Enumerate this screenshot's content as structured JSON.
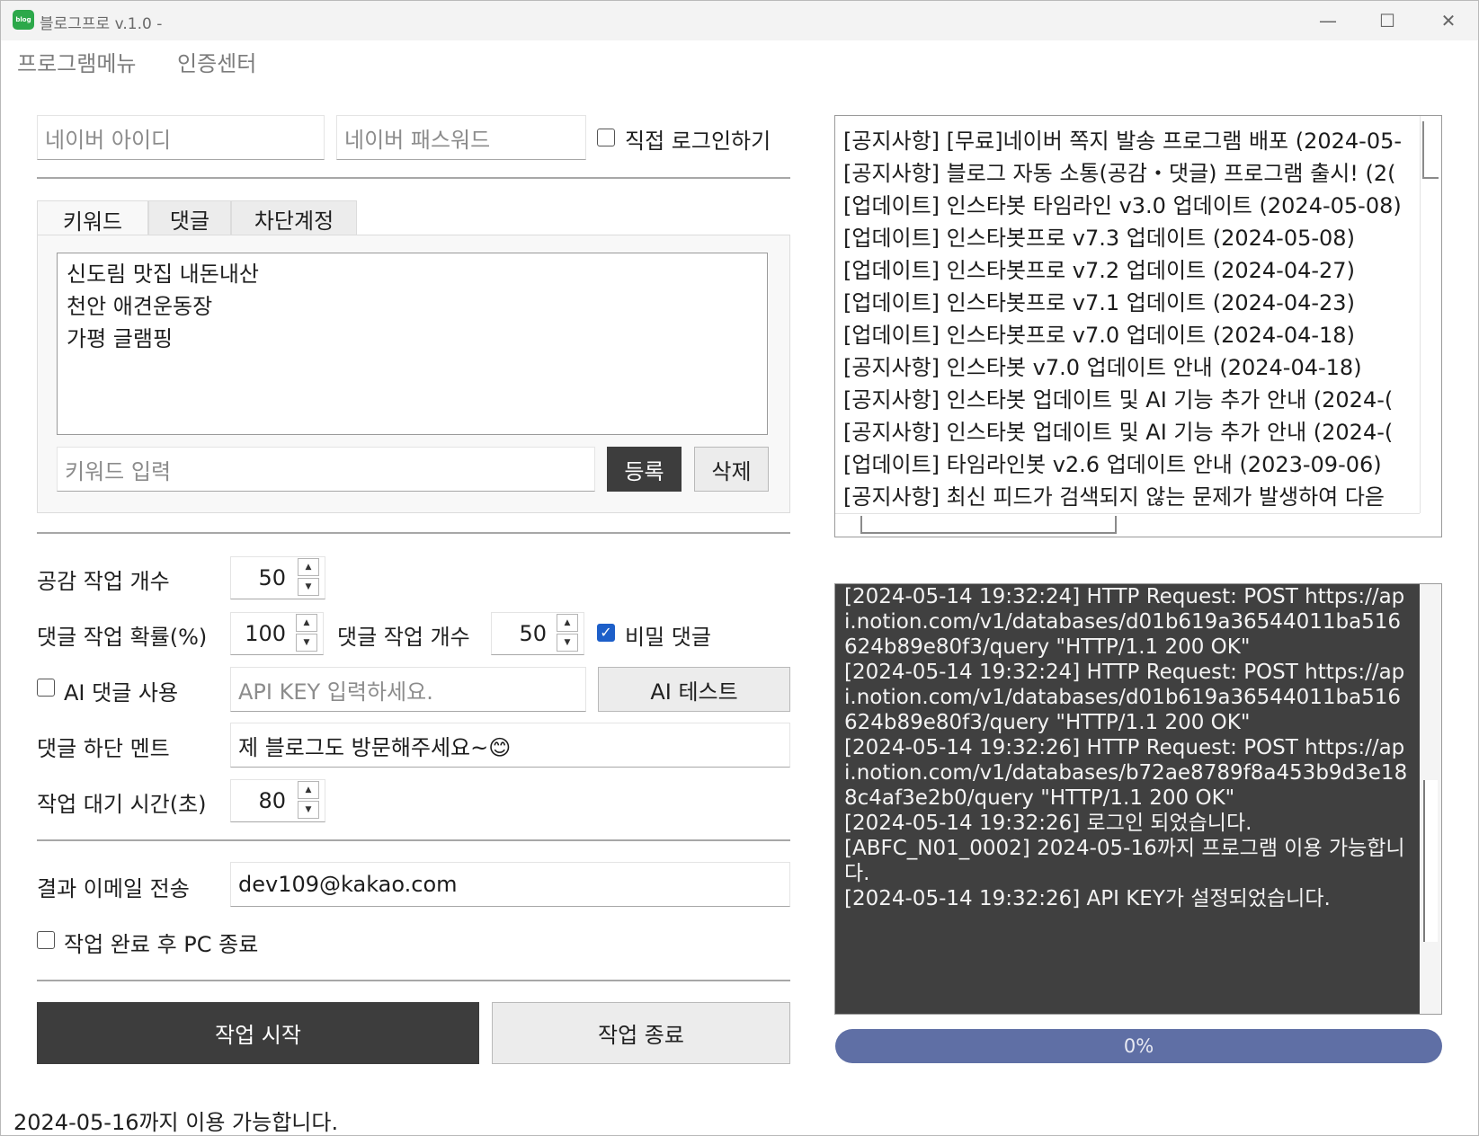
{
  "window": {
    "title": "블로그프로 v.1.0 -",
    "icon_text": "blog",
    "minimize_glyph": "—",
    "maximize_glyph": "☐",
    "close_glyph": "✕"
  },
  "menu": {
    "program_menu": "프로그램메뉴",
    "auth_center": "인증센터"
  },
  "login": {
    "id_placeholder": "네이버 아이디",
    "pw_placeholder": "네이버 패스워드",
    "direct_login_label": "직접 로그인하기",
    "direct_login_checked": false
  },
  "tabs": [
    {
      "label": "키워드",
      "active": true
    },
    {
      "label": "댓글",
      "active": false
    },
    {
      "label": "차단계정",
      "active": false
    }
  ],
  "keywords": {
    "items": [
      "신도림 맛집 내돈내산",
      "천안 애견운동장",
      "가평 글램핑"
    ],
    "input_placeholder": "키워드 입력",
    "register_label": "등록",
    "delete_label": "삭제"
  },
  "settings": {
    "like_count_label": "공감 작업 개수",
    "like_count_value": "50",
    "comment_prob_label": "댓글 작업 확률(%)",
    "comment_prob_value": "100",
    "comment_count_label": "댓글 작업 개수",
    "comment_count_value": "50",
    "secret_comment_label": "비밀 댓글",
    "secret_comment_checked": true,
    "ai_comment_label": "AI 댓글 사용",
    "ai_comment_checked": false,
    "api_key_placeholder": "API KEY 입력하세요.",
    "ai_test_label": "AI 테스트",
    "footer_label": "댓글 하단 멘트",
    "footer_value": "제 블로그도 방문해주세요~😊",
    "wait_label": "작업 대기 시간(초)",
    "wait_value": "80",
    "email_label": "결과 이메일 전송",
    "email_value": "dev109@kakao.com",
    "shutdown_label": "작업 완료 후 PC 종료",
    "shutdown_checked": false
  },
  "actions": {
    "start_label": "작업 시작",
    "stop_label": "작업 종료"
  },
  "notices": [
    "[공지사항] [무료]네이버 쪽지 발송 프로그램 배포 (2024-05-",
    "[공지사항] 블로그 자동 소통(공감・댓글) 프로그램 출시! (2(",
    "[업데이트] 인스타봇 타임라인 v3.0 업데이트 (2024-05-08)",
    "[업데이트] 인스타봇프로 v7.3 업데이트 (2024-05-08)",
    "[업데이트] 인스타봇프로 v7.2 업데이트 (2024-04-27)",
    "[업데이트] 인스타봇프로 v7.1 업데이트 (2024-04-23)",
    "[업데이트] 인스타봇프로 v7.0 업데이트 (2024-04-18)",
    "[공지사항] 인스타봇 v7.0 업데이트 안내 (2024-04-18)",
    "[공지사항] 인스타봇 업데이트 및 AI 기능 추가 안내 (2024-(",
    "[공지사항] 인스타봇 업데이트 및 AI 기능 추가 안내 (2024-(",
    "[업데이트] 타임라인봇 v2.6 업데이트 안내 (2023-09-06)",
    "[공지사항] 최신 피드가 검색되지 않는 문제가 발생하여 다읃"
  ],
  "log_text": "[2024-05-14 19:32:24] HTTP Request: POST https://api.notion.com/v1/databases/d01b619a36544011ba516624b89e80f3/query \"HTTP/1.1 200 OK\"\n[2024-05-14 19:32:24] HTTP Request: POST https://api.notion.com/v1/databases/d01b619a36544011ba516624b89e80f3/query \"HTTP/1.1 200 OK\"\n[2024-05-14 19:32:26] HTTP Request: POST https://api.notion.com/v1/databases/b72ae8789f8a453b9d3e188c4af3e2b0/query \"HTTP/1.1 200 OK\"\n[2024-05-14 19:32:26] 로그인 되었습니다.\n[ABFC_N01_0002] 2024-05-16까지 프로그램 이용 가능합니다.\n[2024-05-14 19:32:26] API KEY가 설정되었습니다.",
  "progress": {
    "label": "0%",
    "value": 0
  },
  "status_text": "2024-05-16까지 이용 가능합니다.",
  "colors": {
    "dark_button": "#3d3d3d",
    "log_background": "#404040",
    "progress_bar": "#5f6fa5",
    "checkbox_checked": "#1d5fc9"
  }
}
